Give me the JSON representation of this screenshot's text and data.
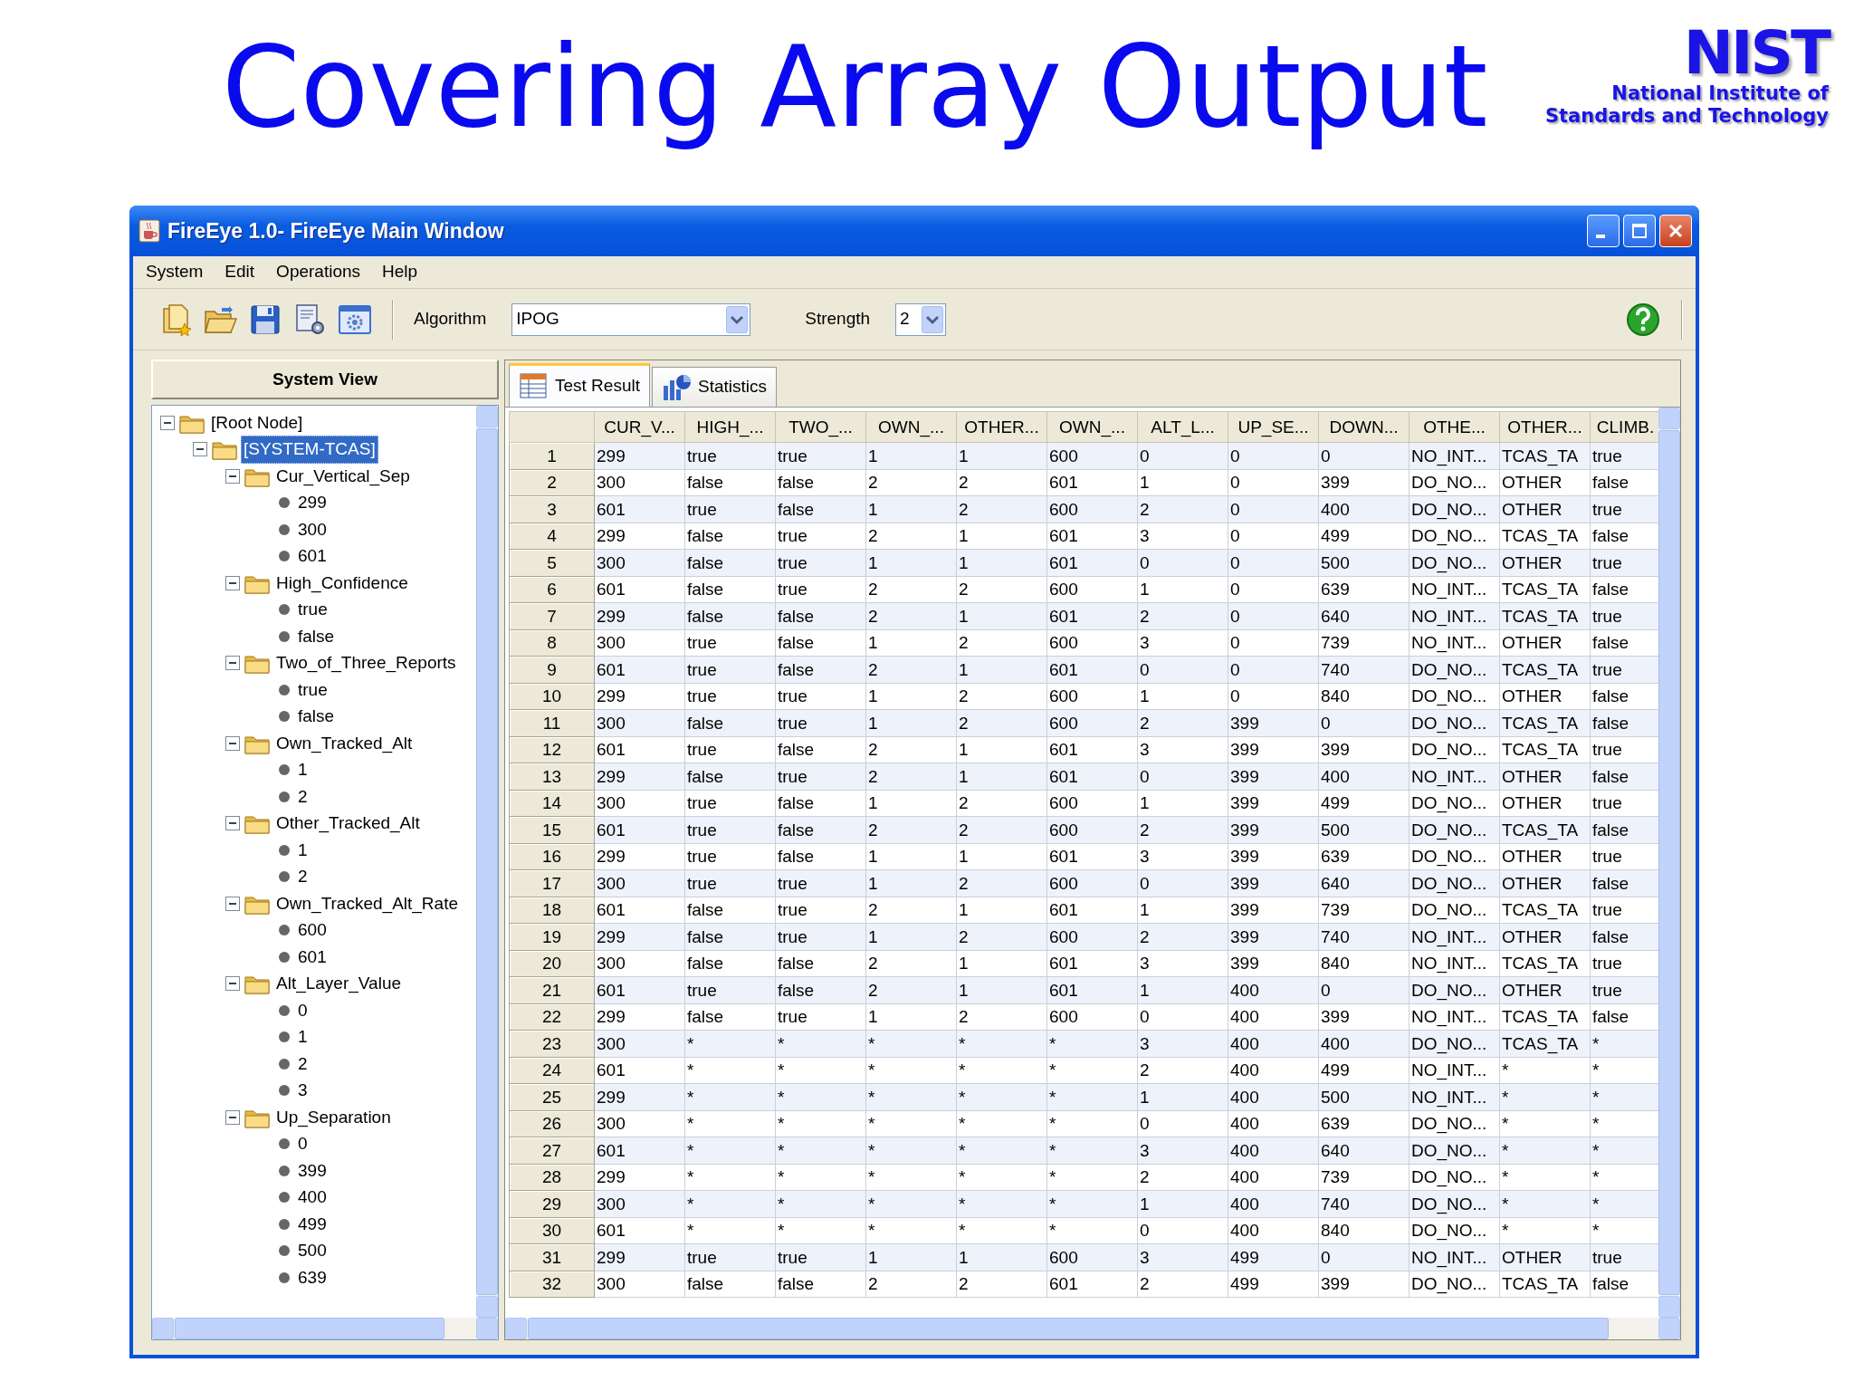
{
  "slide": {
    "title": "Covering Array Output",
    "logo": {
      "wordmark": "NIST",
      "lines": [
        "National Institute of",
        "Standards and Technology"
      ]
    }
  },
  "window": {
    "title": "FireEye 1.0- FireEye Main Window"
  },
  "menu": [
    "System",
    "Edit",
    "Operations",
    "Help"
  ],
  "toolbar": {
    "algorithm": {
      "label": "Algorithm",
      "value": "IPOG"
    },
    "strength": {
      "label": "Strength",
      "value": "2"
    }
  },
  "system_view": {
    "title": "System View",
    "tree": [
      {
        "label": "[Root Node]",
        "selected": false,
        "expanded": true,
        "children": [
          {
            "label": "[SYSTEM-TCAS]",
            "selected": true,
            "expanded": true,
            "children": [
              {
                "label": "Cur_Vertical_Sep",
                "selected": false,
                "expanded": true,
                "children": [
                  {
                    "label": "299",
                    "selected": false
                  },
                  {
                    "label": "300",
                    "selected": false
                  },
                  {
                    "label": "601",
                    "selected": false
                  }
                ]
              },
              {
                "label": "High_Confidence",
                "selected": false,
                "expanded": true,
                "children": [
                  {
                    "label": "true",
                    "selected": false
                  },
                  {
                    "label": "false",
                    "selected": false
                  }
                ]
              },
              {
                "label": "Two_of_Three_Reports",
                "selected": false,
                "expanded": true,
                "children": [
                  {
                    "label": "true",
                    "selected": false
                  },
                  {
                    "label": "false",
                    "selected": false
                  }
                ]
              },
              {
                "label": "Own_Tracked_Alt",
                "selected": false,
                "expanded": true,
                "children": [
                  {
                    "label": "1",
                    "selected": false
                  },
                  {
                    "label": "2",
                    "selected": false
                  }
                ]
              },
              {
                "label": "Other_Tracked_Alt",
                "selected": false,
                "expanded": true,
                "children": [
                  {
                    "label": "1",
                    "selected": false
                  },
                  {
                    "label": "2",
                    "selected": false
                  }
                ]
              },
              {
                "label": "Own_Tracked_Alt_Rate",
                "selected": false,
                "expanded": true,
                "children": [
                  {
                    "label": "600",
                    "selected": false
                  },
                  {
                    "label": "601",
                    "selected": false
                  }
                ]
              },
              {
                "label": "Alt_Layer_Value",
                "selected": false,
                "expanded": true,
                "children": [
                  {
                    "label": "0",
                    "selected": false
                  },
                  {
                    "label": "1",
                    "selected": false
                  },
                  {
                    "label": "2",
                    "selected": false
                  },
                  {
                    "label": "3",
                    "selected": false
                  }
                ]
              },
              {
                "label": "Up_Separation",
                "selected": false,
                "expanded": true,
                "children": [
                  {
                    "label": "0",
                    "selected": false
                  },
                  {
                    "label": "399",
                    "selected": false
                  },
                  {
                    "label": "400",
                    "selected": false
                  },
                  {
                    "label": "499",
                    "selected": false
                  },
                  {
                    "label": "500",
                    "selected": false
                  },
                  {
                    "label": "639",
                    "selected": false
                  }
                ]
              }
            ]
          }
        ]
      }
    ]
  },
  "tabs": [
    {
      "label": "Test Result",
      "selected": true
    },
    {
      "label": "Statistics",
      "selected": false
    }
  ],
  "table": {
    "columns": [
      "CUR_V...",
      "HIGH_...",
      "TWO_...",
      "OWN_...",
      "OTHER...",
      "OWN_...",
      "ALT_L...",
      "UP_SE...",
      "DOWN...",
      "OTHE...",
      "OTHER...",
      "CLIMB."
    ],
    "rows": [
      {
        "header": "1",
        "cells": [
          "299",
          "true",
          "true",
          "1",
          "1",
          "600",
          "0",
          "0",
          "0",
          "NO_INT...",
          "TCAS_TA",
          "true"
        ]
      },
      {
        "header": "2",
        "cells": [
          "300",
          "false",
          "false",
          "2",
          "2",
          "601",
          "1",
          "0",
          "399",
          "DO_NO...",
          "OTHER",
          "false"
        ]
      },
      {
        "header": "3",
        "cells": [
          "601",
          "true",
          "false",
          "1",
          "2",
          "600",
          "2",
          "0",
          "400",
          "DO_NO...",
          "OTHER",
          "true"
        ]
      },
      {
        "header": "4",
        "cells": [
          "299",
          "false",
          "true",
          "2",
          "1",
          "601",
          "3",
          "0",
          "499",
          "DO_NO...",
          "TCAS_TA",
          "false"
        ]
      },
      {
        "header": "5",
        "cells": [
          "300",
          "false",
          "true",
          "1",
          "1",
          "601",
          "0",
          "0",
          "500",
          "DO_NO...",
          "OTHER",
          "true"
        ]
      },
      {
        "header": "6",
        "cells": [
          "601",
          "false",
          "true",
          "2",
          "2",
          "600",
          "1",
          "0",
          "639",
          "NO_INT...",
          "TCAS_TA",
          "false"
        ]
      },
      {
        "header": "7",
        "cells": [
          "299",
          "false",
          "false",
          "2",
          "1",
          "601",
          "2",
          "0",
          "640",
          "NO_INT...",
          "TCAS_TA",
          "true"
        ]
      },
      {
        "header": "8",
        "cells": [
          "300",
          "true",
          "false",
          "1",
          "2",
          "600",
          "3",
          "0",
          "739",
          "NO_INT...",
          "OTHER",
          "false"
        ]
      },
      {
        "header": "9",
        "cells": [
          "601",
          "true",
          "false",
          "2",
          "1",
          "601",
          "0",
          "0",
          "740",
          "DO_NO...",
          "TCAS_TA",
          "true"
        ]
      },
      {
        "header": "10",
        "cells": [
          "299",
          "true",
          "true",
          "1",
          "2",
          "600",
          "1",
          "0",
          "840",
          "DO_NO...",
          "OTHER",
          "false"
        ]
      },
      {
        "header": "11",
        "cells": [
          "300",
          "false",
          "true",
          "1",
          "2",
          "600",
          "2",
          "399",
          "0",
          "DO_NO...",
          "TCAS_TA",
          "false"
        ]
      },
      {
        "header": "12",
        "cells": [
          "601",
          "true",
          "false",
          "2",
          "1",
          "601",
          "3",
          "399",
          "399",
          "DO_NO...",
          "TCAS_TA",
          "true"
        ]
      },
      {
        "header": "13",
        "cells": [
          "299",
          "false",
          "true",
          "2",
          "1",
          "601",
          "0",
          "399",
          "400",
          "NO_INT...",
          "OTHER",
          "false"
        ]
      },
      {
        "header": "14",
        "cells": [
          "300",
          "true",
          "false",
          "1",
          "2",
          "600",
          "1",
          "399",
          "499",
          "DO_NO...",
          "OTHER",
          "true"
        ]
      },
      {
        "header": "15",
        "cells": [
          "601",
          "true",
          "false",
          "2",
          "2",
          "600",
          "2",
          "399",
          "500",
          "DO_NO...",
          "TCAS_TA",
          "false"
        ]
      },
      {
        "header": "16",
        "cells": [
          "299",
          "true",
          "false",
          "1",
          "1",
          "601",
          "3",
          "399",
          "639",
          "DO_NO...",
          "OTHER",
          "true"
        ]
      },
      {
        "header": "17",
        "cells": [
          "300",
          "true",
          "true",
          "1",
          "2",
          "600",
          "0",
          "399",
          "640",
          "DO_NO...",
          "OTHER",
          "false"
        ]
      },
      {
        "header": "18",
        "cells": [
          "601",
          "false",
          "true",
          "2",
          "1",
          "601",
          "1",
          "399",
          "739",
          "DO_NO...",
          "TCAS_TA",
          "true"
        ]
      },
      {
        "header": "19",
        "cells": [
          "299",
          "false",
          "true",
          "1",
          "2",
          "600",
          "2",
          "399",
          "740",
          "NO_INT...",
          "OTHER",
          "false"
        ]
      },
      {
        "header": "20",
        "cells": [
          "300",
          "false",
          "false",
          "2",
          "1",
          "601",
          "3",
          "399",
          "840",
          "NO_INT...",
          "TCAS_TA",
          "true"
        ]
      },
      {
        "header": "21",
        "cells": [
          "601",
          "true",
          "false",
          "2",
          "1",
          "601",
          "1",
          "400",
          "0",
          "DO_NO...",
          "OTHER",
          "true"
        ]
      },
      {
        "header": "22",
        "cells": [
          "299",
          "false",
          "true",
          "1",
          "2",
          "600",
          "0",
          "400",
          "399",
          "NO_INT...",
          "TCAS_TA",
          "false"
        ]
      },
      {
        "header": "23",
        "cells": [
          "300",
          "*",
          "*",
          "*",
          "*",
          "*",
          "3",
          "400",
          "400",
          "DO_NO...",
          "TCAS_TA",
          "*"
        ]
      },
      {
        "header": "24",
        "cells": [
          "601",
          "*",
          "*",
          "*",
          "*",
          "*",
          "2",
          "400",
          "499",
          "NO_INT...",
          "*",
          "*"
        ]
      },
      {
        "header": "25",
        "cells": [
          "299",
          "*",
          "*",
          "*",
          "*",
          "*",
          "1",
          "400",
          "500",
          "NO_INT...",
          "*",
          "*"
        ]
      },
      {
        "header": "26",
        "cells": [
          "300",
          "*",
          "*",
          "*",
          "*",
          "*",
          "0",
          "400",
          "639",
          "DO_NO...",
          "*",
          "*"
        ]
      },
      {
        "header": "27",
        "cells": [
          "601",
          "*",
          "*",
          "*",
          "*",
          "*",
          "3",
          "400",
          "640",
          "DO_NO...",
          "*",
          "*"
        ]
      },
      {
        "header": "28",
        "cells": [
          "299",
          "*",
          "*",
          "*",
          "*",
          "*",
          "2",
          "400",
          "739",
          "DO_NO...",
          "*",
          "*"
        ]
      },
      {
        "header": "29",
        "cells": [
          "300",
          "*",
          "*",
          "*",
          "*",
          "*",
          "1",
          "400",
          "740",
          "DO_NO...",
          "*",
          "*"
        ]
      },
      {
        "header": "30",
        "cells": [
          "601",
          "*",
          "*",
          "*",
          "*",
          "*",
          "0",
          "400",
          "840",
          "DO_NO...",
          "*",
          "*"
        ]
      },
      {
        "header": "31",
        "cells": [
          "299",
          "true",
          "true",
          "1",
          "1",
          "600",
          "3",
          "499",
          "0",
          "NO_INT...",
          "OTHER",
          "true"
        ]
      },
      {
        "header": "32",
        "cells": [
          "300",
          "false",
          "false",
          "2",
          "2",
          "601",
          "2",
          "499",
          "399",
          "DO_NO...",
          "TCAS_TA",
          "false"
        ]
      }
    ]
  }
}
